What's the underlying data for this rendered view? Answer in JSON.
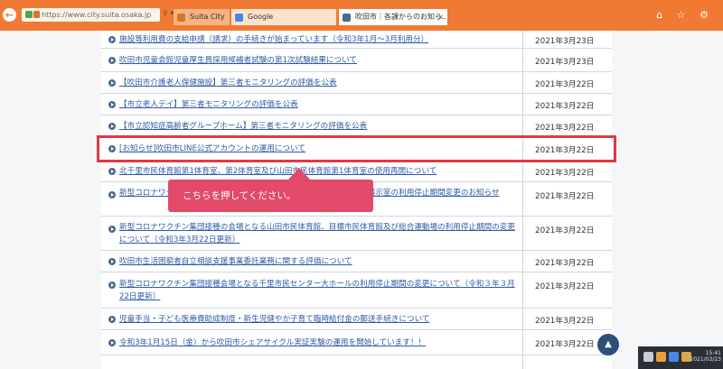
{
  "browser": {
    "address": "https://www.city.suita.osaka.jp",
    "address_buttons": "⚲ ▾ ⟳",
    "tabs": [
      {
        "label": "Suita City",
        "icon_color": "#d07a2a"
      },
      {
        "label": "Google",
        "icon_color": "#4a86e8"
      },
      {
        "label": "吹田市｜各課からのお知ら...",
        "icon_color": "#4c6a8e",
        "close": "×"
      }
    ],
    "right_icons": "⌂ ☆ ⚙"
  },
  "news_list": [
    {
      "title": "施設等利用費の支給申請（請求）の手続きが始まっています（令和3年1月～3月利用分）",
      "date": "2021年3月23日"
    },
    {
      "title": "吹田市児童会館児童厚生員採用候補者試験の第1次試験結果について",
      "date": "2021年3月23日"
    },
    {
      "title": "【吹田市介護老人保健施設】第三者モニタリングの評価を公表",
      "date": "2021年3月22日"
    },
    {
      "title": "【市立老人デイ】第三者モニタリングの評価を公表",
      "date": "2021年3月22日"
    },
    {
      "title": "【市立認知症高齢者グループホーム】第三者モニタリングの評価を公表",
      "date": "2021年3月22日"
    },
    {
      "title": "[お知らせ]吹田市LINE公式アカウントの運用について",
      "date": "2021年3月22日"
    },
    {
      "title": "北千里市民体育館第1体育室、第2体育室及び山田市民体育館第1体育室の使用再開について",
      "date": "2021年3月22日"
    },
    {
      "title": "新型コロナワクチン集団接種の会場となる（市民センター）集会室及び展示室の利用停止期間変更のお知らせ",
      "date": "2021年3月22日"
    },
    {
      "title": "新型コロナワクチン集団接種の会場となる山田市民体育館、目標市民体育館及び総合運動場の利用停止期間の変更について（令和3年3月22日更新）",
      "date": "2021年3月22日"
    },
    {
      "title": "吹田市生活困窮者自立相談支援事業委託業務に関する評価について",
      "date": "2021年3月22日"
    },
    {
      "title": "新型コロナワクチン集団接種会場となる千里市民センター大ホールの利用停止期間の変更について（令和３年３月22日更新）",
      "date": "2021年3月22日"
    },
    {
      "title": "児童手当・子ども医療費助成制度・新生児健やか子育て臨時給付金の郵送手続きについて",
      "date": "2021年3月22日"
    },
    {
      "title": "令和3年1月15日（金）から吹田市シェアサイクル実証実験の運用を開始しています！！",
      "date": "2021年3月22日"
    }
  ],
  "callout": {
    "text": "こちらを押してください。"
  },
  "scroll_top": {
    "symbol": "▲"
  },
  "tray": {
    "clock_time": "15:41",
    "clock_date": "2021/03/23"
  },
  "colors": {
    "accent": "#f07a33",
    "highlight": "#e03a44",
    "callout": "#e24a6a",
    "link": "#2e5ba6"
  }
}
